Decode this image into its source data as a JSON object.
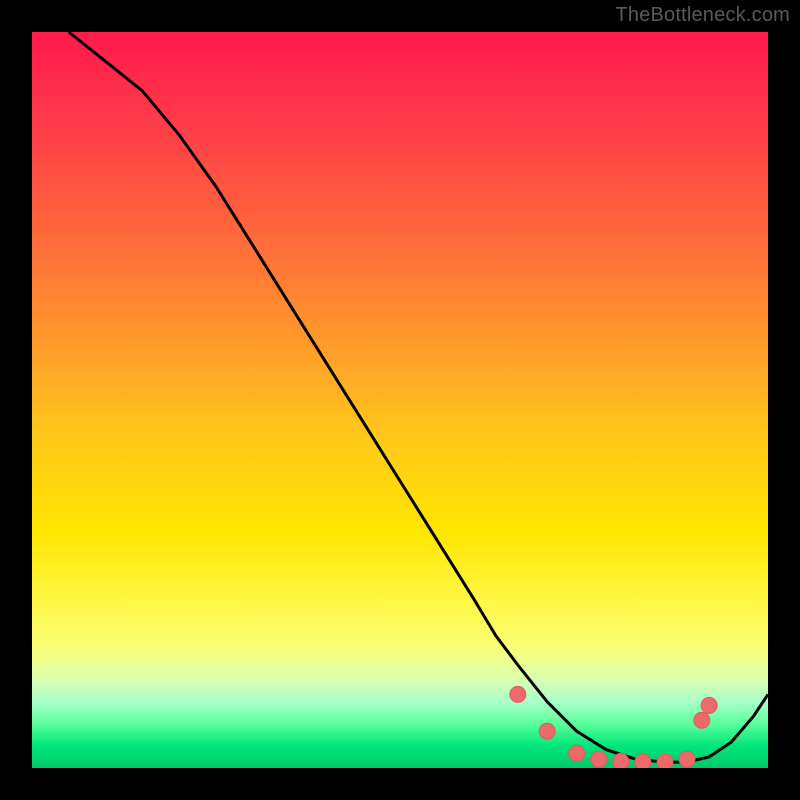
{
  "watermark": "TheBottleneck.com",
  "chart_data": {
    "type": "line",
    "title": "",
    "xlabel": "",
    "ylabel": "",
    "xlim": [
      0,
      100
    ],
    "ylim": [
      0,
      100
    ],
    "grid": false,
    "legend": false,
    "series": [
      {
        "name": "bottleneck-curve",
        "x": [
          5,
          10,
          15,
          20,
          25,
          30,
          35,
          40,
          45,
          50,
          55,
          60,
          63,
          66,
          70,
          74,
          78,
          82,
          86,
          89,
          92,
          95,
          98,
          100
        ],
        "y": [
          100,
          96,
          92,
          86,
          79,
          71,
          63,
          55,
          47,
          39,
          31,
          23,
          18,
          14,
          9,
          5,
          2.5,
          1.2,
          0.8,
          0.8,
          1.5,
          3.5,
          7,
          10
        ]
      }
    ],
    "markers": [
      {
        "x": 66,
        "y": 10
      },
      {
        "x": 70,
        "y": 5
      },
      {
        "x": 74,
        "y": 2.0
      },
      {
        "x": 77,
        "y": 1.2
      },
      {
        "x": 80,
        "y": 0.9
      },
      {
        "x": 83,
        "y": 0.8
      },
      {
        "x": 86,
        "y": 0.8
      },
      {
        "x": 89,
        "y": 1.2
      },
      {
        "x": 91,
        "y": 6.5
      },
      {
        "x": 92,
        "y": 8.5
      }
    ],
    "colors": {
      "curve": "#000000",
      "marker_fill": "#ec6a6a",
      "marker_stroke": "#e05a5a"
    }
  }
}
